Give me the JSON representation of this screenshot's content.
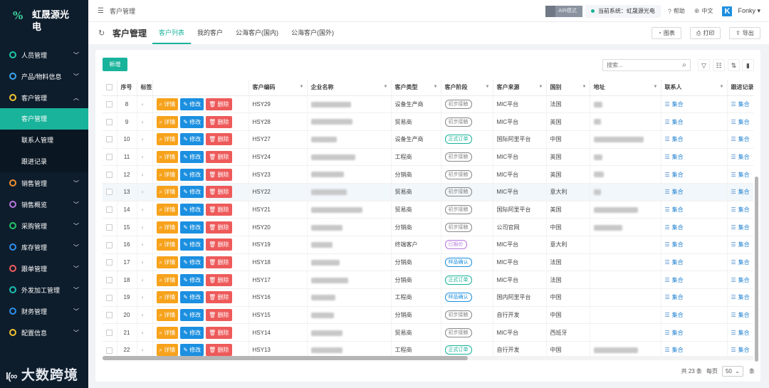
{
  "sidebar": {
    "logo_text": "虹晟源光电",
    "logo_mark": "%",
    "items": [
      {
        "label": "人员管理",
        "color": "#1ec8a6",
        "expanded": false
      },
      {
        "label": "产品/物料信息",
        "color": "#3aa4ef",
        "expanded": false
      },
      {
        "label": "客户管理",
        "color": "#f2c230",
        "expanded": true
      },
      {
        "label": "销售管理",
        "color": "#f08f2e",
        "expanded": false
      },
      {
        "label": "销售概览",
        "color": "#b777e0",
        "expanded": false
      },
      {
        "label": "采购管理",
        "color": "#25c46a",
        "expanded": false
      },
      {
        "label": "库存管理",
        "color": "#2f8fee",
        "expanded": false
      },
      {
        "label": "跟单管理",
        "color": "#ef5d5d",
        "expanded": false
      },
      {
        "label": "外发加工管理",
        "color": "#19c0b0",
        "expanded": false
      },
      {
        "label": "财务管理",
        "color": "#2f8fee",
        "expanded": false
      },
      {
        "label": "配置信息",
        "color": "#f2c230",
        "expanded": false
      }
    ],
    "submenu": [
      "客户管理",
      "联系人管理",
      "跟进记录"
    ],
    "watermark": "大数跨境"
  },
  "topbar": {
    "breadcrumb": "客户管理",
    "air_mode": "AIR模式",
    "system_prefix": "当前系统：",
    "system_name": "虹晟源光电",
    "help": "帮助",
    "language": "中文",
    "user": "Fonky"
  },
  "tabbar": {
    "title": "客户管理",
    "tabs": [
      "客户列表",
      "我的客户",
      "公海客户(国内)",
      "公海客户(国外)"
    ],
    "active_tab": 0,
    "chart_btn": "图表",
    "print_btn": "打印",
    "export_btn": "导出"
  },
  "toolbar": {
    "add_label": "新增",
    "search_placeholder": "搜索..."
  },
  "table": {
    "columns": [
      "序号",
      "标签",
      "",
      "客户编码",
      "企业名称",
      "客户类型",
      "客户阶段",
      "客户来源",
      "国别",
      "地址",
      "联系人",
      "跟进记录"
    ],
    "action_labels": {
      "detail": "详情",
      "edit": "修改",
      "delete": "删除"
    },
    "link_label": "集合",
    "stage_colors": {
      "初步接触": "#888888",
      "正式订单": "#19b39b",
      "样品确认": "#1b8fe0",
      "已报价": "#b777e0"
    },
    "rows": [
      {
        "no": "8",
        "code": "HSY29",
        "type": "设备生产商",
        "stage": "初步接触",
        "source": "MIC平台",
        "country": "法国"
      },
      {
        "no": "9",
        "code": "HSY28",
        "type": "贸易商",
        "stage": "初步接触",
        "source": "MIC平台",
        "country": "英国"
      },
      {
        "no": "10",
        "code": "HSY27",
        "type": "设备生产商",
        "stage": "正式订单",
        "source": "国际阿里平台",
        "country": "中国"
      },
      {
        "no": "11",
        "code": "HSY24",
        "type": "工程商",
        "stage": "初步接触",
        "source": "MIC平台",
        "country": "英国"
      },
      {
        "no": "12",
        "code": "HSY23",
        "type": "分销商",
        "stage": "初步接触",
        "source": "MIC平台",
        "country": "英国"
      },
      {
        "no": "13",
        "code": "HSY22",
        "type": "贸易商",
        "stage": "初步接触",
        "source": "MIC平台",
        "country": "意大利"
      },
      {
        "no": "14",
        "code": "HSY21",
        "type": "贸易商",
        "stage": "初步接触",
        "source": "国际阿里平台",
        "country": "美国"
      },
      {
        "no": "15",
        "code": "HSY20",
        "type": "分销商",
        "stage": "初步接触",
        "source": "公司官网",
        "country": "中国"
      },
      {
        "no": "16",
        "code": "HSY19",
        "type": "终端客户",
        "stage": "已报价",
        "source": "MIC平台",
        "country": "意大利"
      },
      {
        "no": "17",
        "code": "HSY18",
        "type": "分销商",
        "stage": "样品确认",
        "source": "MIC平台",
        "country": "法国"
      },
      {
        "no": "18",
        "code": "HSY17",
        "type": "分销商",
        "stage": "正式订单",
        "source": "MIC平台",
        "country": "法国"
      },
      {
        "no": "19",
        "code": "HSY16",
        "type": "工程商",
        "stage": "样品确认",
        "source": "国内阿里平台",
        "country": "中国"
      },
      {
        "no": "20",
        "code": "HSY15",
        "type": "分销商",
        "stage": "初步接触",
        "source": "自行开发",
        "country": "中国"
      },
      {
        "no": "21",
        "code": "HSY14",
        "type": "贸易商",
        "stage": "初步接触",
        "source": "MIC平台",
        "country": "西班牙"
      },
      {
        "no": "22",
        "code": "HSY13",
        "type": "工程商",
        "stage": "正式订单",
        "source": "自行开发",
        "country": "中国"
      }
    ]
  },
  "pager": {
    "total": "共 23 条",
    "per_page_label": "每页",
    "page_size": "50",
    "unit": "条"
  }
}
